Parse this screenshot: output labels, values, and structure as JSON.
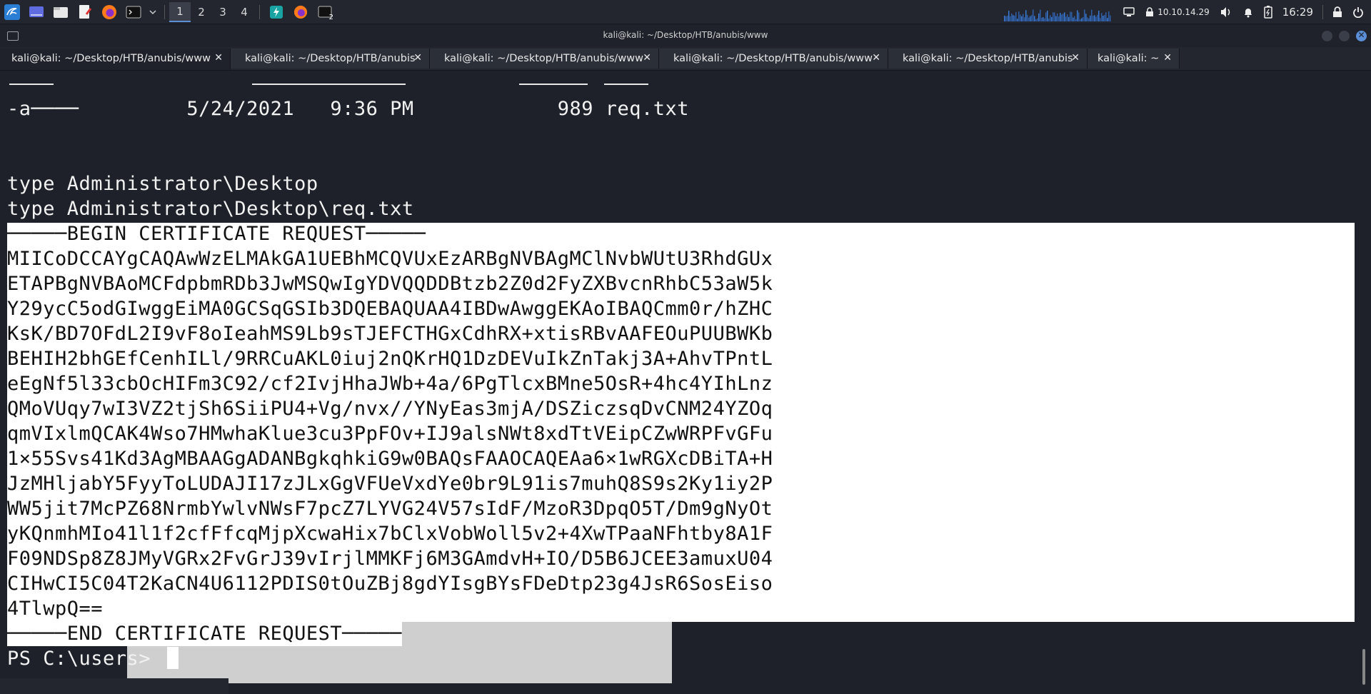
{
  "panel": {
    "workspaces": [
      "1",
      "2",
      "3",
      "4"
    ],
    "ip": "10.10.14.29",
    "clock": "16:29",
    "terminal_badge": "2"
  },
  "window": {
    "title": "kali@kali: ~/Desktop/HTB/anubis/www"
  },
  "tabs": [
    {
      "label": "kali@kali: ~/Desktop/HTB/anubis/www",
      "active": true
    },
    {
      "label": "kali@kali: ~/Desktop/HTB/anubis",
      "active": false
    },
    {
      "label": "kali@kali: ~/Desktop/HTB/anubis/www",
      "active": false
    },
    {
      "label": "kali@kali: ~/Desktop/HTB/anubis/www",
      "active": false
    },
    {
      "label": "kali@kali: ~/Desktop/HTB/anubis",
      "active": false
    },
    {
      "label": "kali@kali: ~",
      "active": false
    }
  ],
  "terminal": {
    "listing_row": "-a────         5/24/2021   9:36 PM            989 req.txt",
    "cmd1": "type Administrator\\Desktop",
    "cmd2": "type Administrator\\Desktop\\req.txt",
    "begin": "─────BEGIN CERTIFICATE REQUEST─────",
    "csr_lines": [
      "MIICoDCCAYgCAQAwWzELMAkGA1UEBhMCQVUxEzARBgNVBAgMClNvbWUtU3RhdGUx",
      "ETAPBgNVBAoMCFdpbmRDb3JwMSQwIgYDVQQDDBtzb2Z0d2FyZXBvcnRhbC53aW5k",
      "Y29ycC5odGIwggEiMA0GCSqGSIb3DQEBAQUAA4IBDwAwggEKAoIBAQCmm0r/hZHC",
      "KsK/BD7OFdL2I9vF8oIeahMS9Lb9sTJEFCTHGxCdhRX+xtisRBvAAFEOuPUUBWKb",
      "BEHIH2bhGEfCenhILl/9RRCuAKL0iuj2nQKrHQ1DzDEVuIkZnTakj3A+AhvTPntL",
      "eEgNf5l33cbOcHIFm3C92/cf2IvjHhaJWb+4a/6PgTlcxBMne5OsR+4hc4YIhLnz",
      "QMoVUqy7wI3VZ2tjSh6SiiPU4+Vg/nvx//YNyEas3mjA/DSZiczsqDvCNM24YZOq",
      "qmVIxlmQCAK4Wso7HMwhaKlue3cu3PpFOv+IJ9alsNWt8xdTtVEipCZwWRPFvGFu",
      "1×55Svs41Kd3AgMBAAGgADANBgkqhkiG9w0BAQsFAAOCAQEAa6×1wRGXcDBiTA+H",
      "JzMHljabY5FyyToLUDAJI17zJLxGgVFUeVxdYe0br9L91is7muhQ8S9s2Ky1iy2P",
      "WW5jit7McPZ68NrmbYwlvNWsF7pcZ7LYVG24V57sIdF/MzoR3DpqO5T/Dm9gNyOt",
      "yKQnmhMIo41l1f2cfFfcqMjpXcwaHix7bClxVobWoll5v2+4XwTPaaNFhtby8A1F",
      "F09NDSp8Z8JMyVGRx2FvGrJ39vIrjlMMKFj6M3GAmdvH+IO/D5B6JCEE3amuxU04",
      "CIHwCI5C04T2KaCN4U6112PDIS0tOuZBj8gdYIsgBYsFDeDtp23g4JsR6SosEiso",
      "4TlwpQ=="
    ],
    "end": "─────END CERTIFICATE REQUEST─────",
    "prompt": "PS C:\\users> "
  }
}
